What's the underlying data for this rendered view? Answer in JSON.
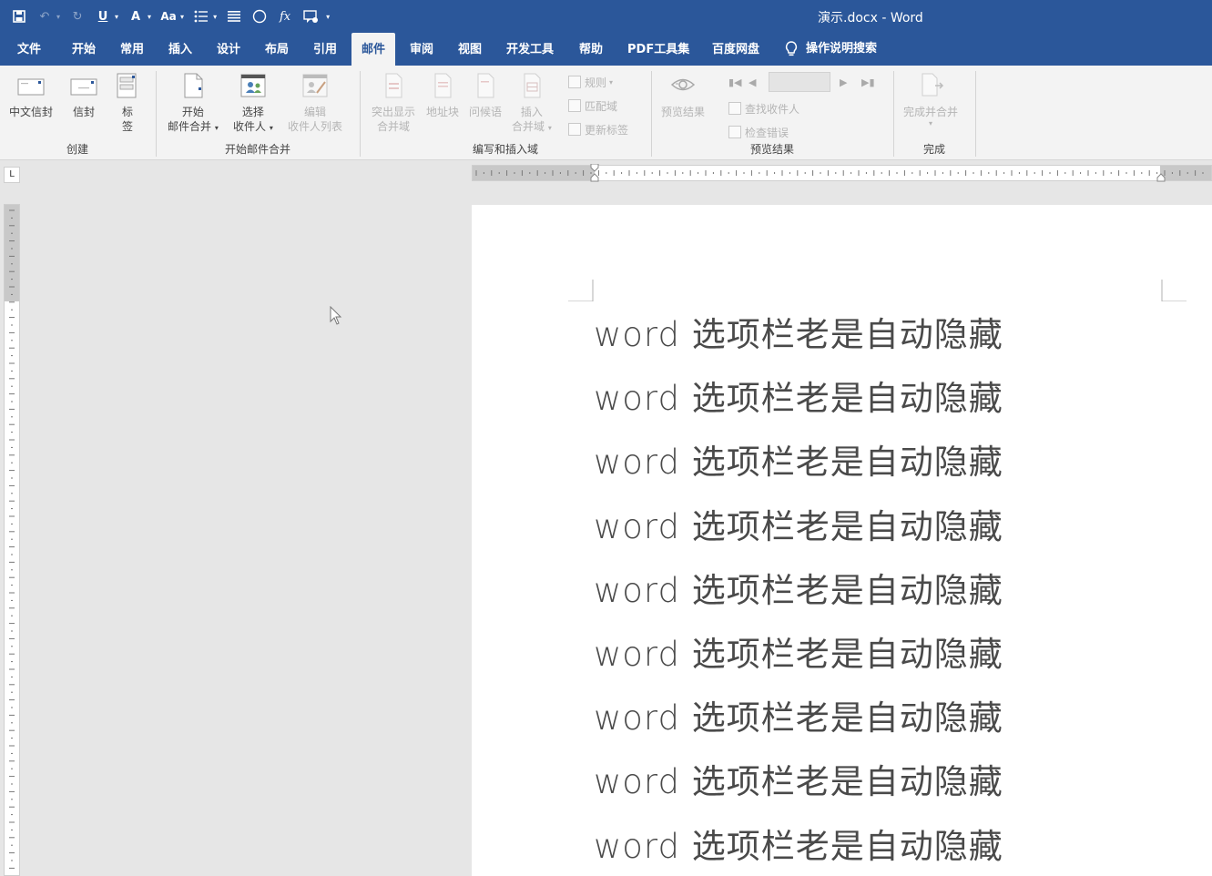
{
  "window": {
    "title": "演示.docx  -  Word"
  },
  "quick_access": [
    {
      "name": "save-icon",
      "glyph": "💾"
    },
    {
      "name": "undo-icon",
      "glyph": "↶"
    },
    {
      "name": "redo-icon",
      "glyph": "↻"
    },
    {
      "name": "underline-icon",
      "glyph": "U"
    },
    {
      "name": "text-effects-icon",
      "glyph": "A"
    },
    {
      "name": "change-case-icon",
      "glyph": "Aa"
    },
    {
      "name": "bullets-icon",
      "glyph": "☰"
    },
    {
      "name": "align-icon",
      "glyph": "≡"
    },
    {
      "name": "shape-circle-icon",
      "glyph": "○"
    },
    {
      "name": "formula-icon",
      "glyph": "fx"
    },
    {
      "name": "comment-icon",
      "glyph": "▭"
    },
    {
      "name": "customize-qat-icon",
      "glyph": "▾"
    }
  ],
  "tabs": [
    "文件",
    "开始",
    "常用",
    "插入",
    "设计",
    "布局",
    "引用",
    "邮件",
    "审阅",
    "视图",
    "开发工具",
    "帮助",
    "PDF工具集",
    "百度网盘",
    "操作说明搜索"
  ],
  "active_tab": "邮件",
  "ribbon": {
    "create": {
      "label": "创建",
      "chinese_envelope": "中文信封",
      "envelope": "信封",
      "labels_line1": "标",
      "labels_line2": "签"
    },
    "start_merge": {
      "label": "开始邮件合并",
      "start_line1": "开始",
      "start_line2": "邮件合并",
      "select_line1": "选择",
      "select_line2": "收件人",
      "edit_line1": "编辑",
      "edit_line2": "收件人列表"
    },
    "write_insert": {
      "label": "编写和插入域",
      "highlight_line1": "突出显示",
      "highlight_line2": "合并域",
      "address_block": "地址块",
      "greeting_line": "问候语",
      "insert_line1": "插入",
      "insert_line2": "合并域",
      "rules": "规则",
      "match_fields": "匹配域",
      "update_labels": "更新标签"
    },
    "preview": {
      "label": "预览结果",
      "preview_results": "预览结果",
      "find_recipient": "查找收件人",
      "check_errors": "检查错误"
    },
    "finish": {
      "label": "完成",
      "finish_merge": "完成并合并"
    }
  },
  "ruler_corner": "L",
  "document": {
    "lines": [
      "word  选项栏老是自动隐藏",
      "word  选项栏老是自动隐藏",
      "word  选项栏老是自动隐藏",
      "word  选项栏老是自动隐藏",
      "word  选项栏老是自动隐藏",
      "word  选项栏老是自动隐藏",
      "word  选项栏老是自动隐藏",
      "word  选项栏老是自动隐藏",
      "word  选项栏老是自动隐藏"
    ]
  },
  "colors": {
    "brand": "#2b579a",
    "ribbon_bg": "#f3f3f3",
    "workspace_bg": "#e6e6e6"
  }
}
